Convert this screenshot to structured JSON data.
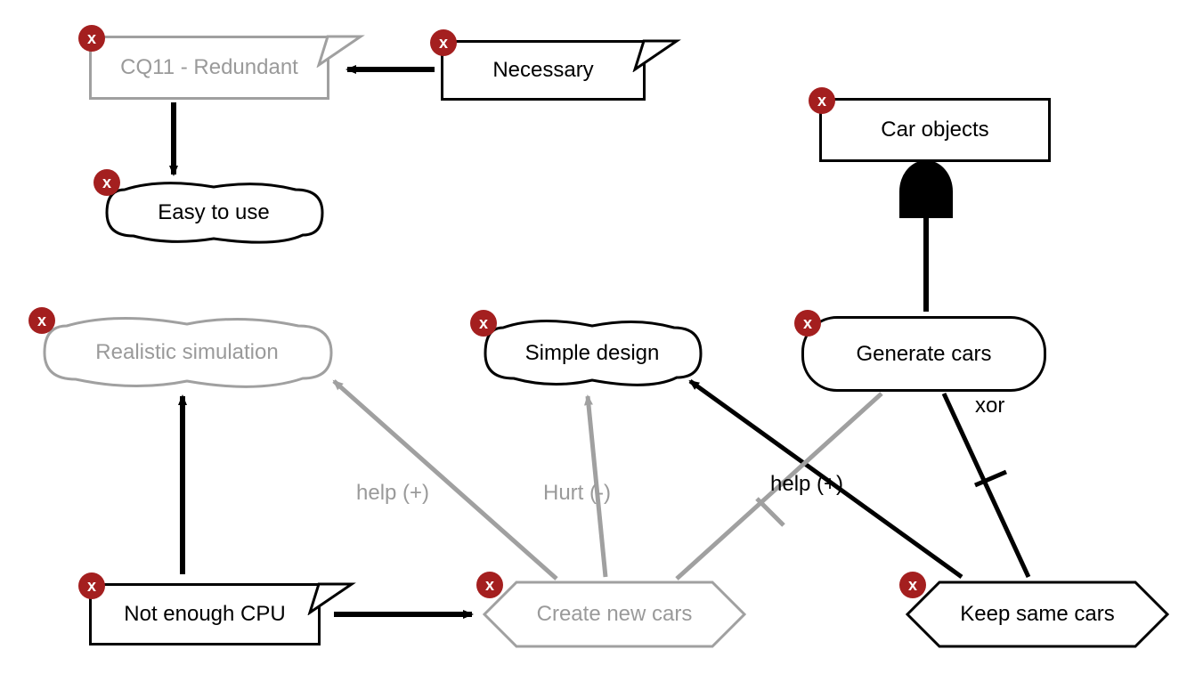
{
  "nodes": {
    "cq11": {
      "label": "CQ11 - Redundant"
    },
    "necessary": {
      "label": "Necessary"
    },
    "easy": {
      "label": "Easy to use"
    },
    "realistic": {
      "label": "Realistic simulation"
    },
    "simple": {
      "label": "Simple design"
    },
    "generate": {
      "label": "Generate cars"
    },
    "carobjects": {
      "label": "Car objects"
    },
    "notcpu": {
      "label": "Not enough CPU"
    },
    "createnew": {
      "label": "Create new cars"
    },
    "keepsame": {
      "label": "Keep same cars"
    }
  },
  "labels": {
    "xor": "xor",
    "help1": "help (+)",
    "hurt": "Hurt (-)",
    "help2": "help (+)"
  },
  "badge": "x",
  "colors": {
    "badge_bg": "#a41f1f",
    "faded": "#a0a0a0",
    "stroke": "#000000"
  }
}
